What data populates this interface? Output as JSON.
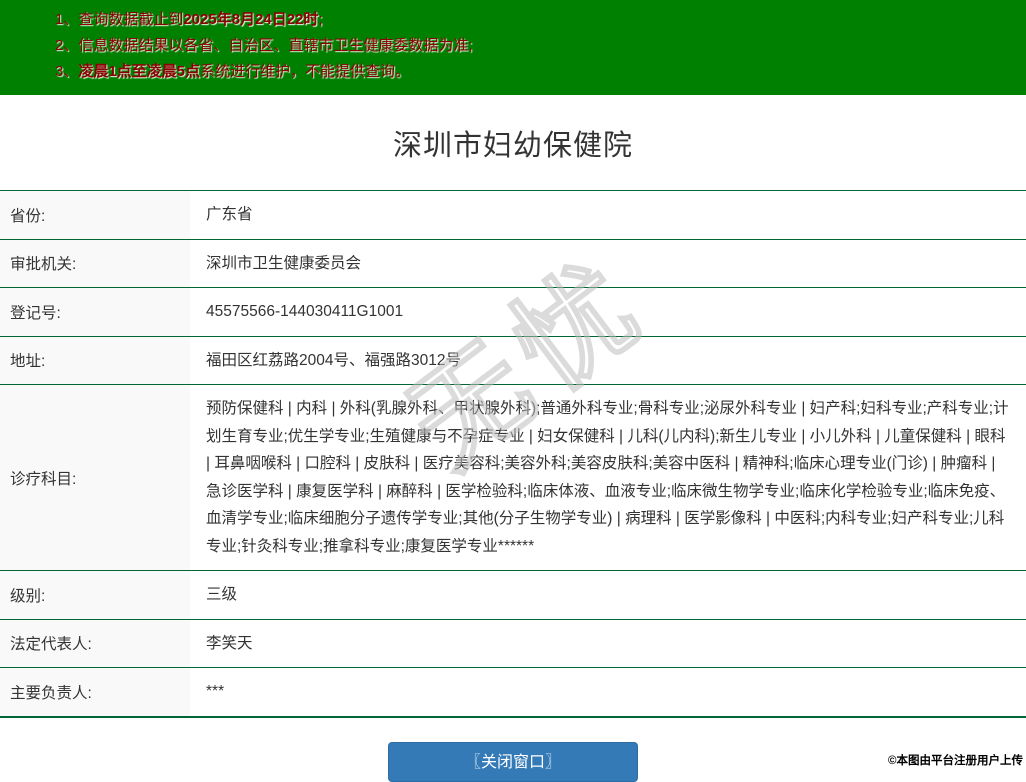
{
  "header": {
    "bg_color": "#008000",
    "text_color": "#8B0000",
    "notices": [
      {
        "prefix": "1、查询数据截止到",
        "bold": "2025年8月24日22时",
        "suffix": ";"
      },
      {
        "prefix": "2、信息数据结果以各省、自治区、直辖市卫生健康委数据为准;",
        "bold": "",
        "suffix": ""
      },
      {
        "prefix": "3、",
        "bold": "凌晨1点至凌晨5点",
        "suffix": "系统进行维护，不能提供查询。"
      }
    ]
  },
  "title": "深圳市妇幼保健院",
  "table": {
    "divider_color": "#006633",
    "label_bg_color": "#f9f9f9",
    "rows": [
      {
        "label": "省份:",
        "value": "广东省"
      },
      {
        "label": "审批机关:",
        "value": "深圳市卫生健康委员会"
      },
      {
        "label": "登记号:",
        "value": "45575566-144030411G1001"
      },
      {
        "label": "地址:",
        "value": "福田区红荔路2004号、福强路3012号"
      },
      {
        "label": "诊疗科目:",
        "value": "预防保健科 | 内科 | 外科(乳腺外科、甲状腺外科);普通外科专业;骨科专业;泌尿外科专业 | 妇产科;妇科专业;产科专业;计划生育专业;优生学专业;生殖健康与不孕症专业 | 妇女保健科 | 儿科(儿内科);新生儿专业 | 小儿外科 | 儿童保健科 | 眼科 | 耳鼻咽喉科 | 口腔科 | 皮肤科 | 医疗美容科;美容外科;美容皮肤科;美容中医科 | 精神科;临床心理专业(门诊) | 肿瘤科 | 急诊医学科 | 康复医学科 | 麻醉科 | 医学检验科;临床体液、血液专业;临床微生物学专业;临床化学检验专业;临床免疫、血清学专业;临床细胞分子遗传学专业;其他(分子生物学专业) | 病理科 | 医学影像科 | 中医科;内科专业;妇产科专业;儿科专业;针灸科专业;推拿科专业;康复医学专业******"
      },
      {
        "label": "级别:",
        "value": "三级"
      },
      {
        "label": "法定代表人:",
        "value": "李笑天"
      },
      {
        "label": "主要负责人:",
        "value": "***"
      }
    ]
  },
  "footer": {
    "close_button_label": "〖关闭窗口〗",
    "button_color": "#337ab7",
    "credit_text": "©本图由平台注册用户上传"
  },
  "watermark": {
    "text": "无忧"
  }
}
